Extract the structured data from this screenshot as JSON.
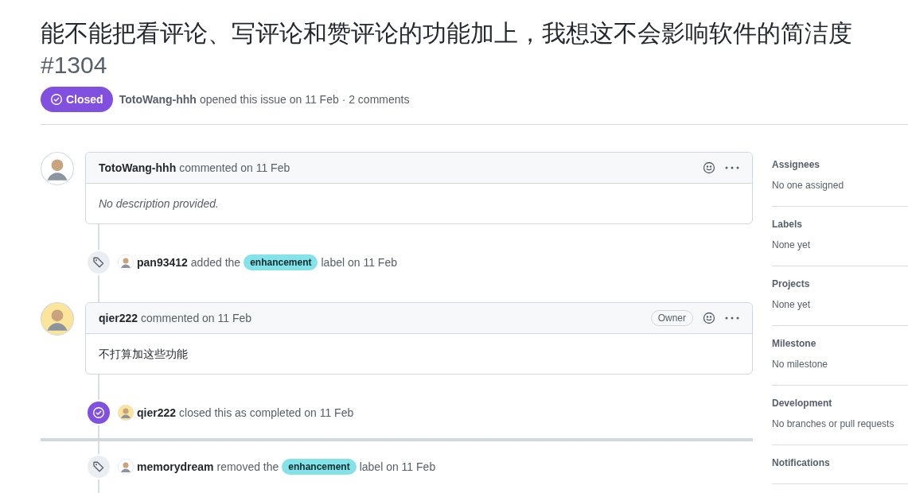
{
  "issue": {
    "title": "能不能把看评论、写评论和赞评论的功能加上，我想这不会影响软件的简洁度",
    "number": "#1304",
    "status": {
      "kind": "closed",
      "label": "Closed"
    },
    "author": "TotoWang-hhh",
    "meta": "opened this issue on 11 Feb · 2 comments"
  },
  "timeline": [
    {
      "kind": "comment",
      "author": "TotoWang-hhh",
      "action": "commented on 11 Feb",
      "body": "No description provided.",
      "empty": true
    },
    {
      "kind": "label_event",
      "actor": "pan93412",
      "before": "added the",
      "label": "enhancement",
      "after": "label on 11 Feb"
    },
    {
      "kind": "comment",
      "author": "qier222",
      "action": "commented on 11 Feb",
      "badge": "Owner",
      "body": "不打算加这些功能",
      "empty": false
    },
    {
      "kind": "close_event",
      "actor": "qier222",
      "before": "closed this as completed on 11 Feb"
    },
    {
      "kind": "label_event",
      "actor": "memorydream",
      "before": "removed the",
      "label": "enhancement",
      "after": "label on 11 Feb"
    }
  ],
  "sidebar": [
    {
      "heading": "Assignees",
      "value": "No one assigned"
    },
    {
      "heading": "Labels",
      "value": "None yet"
    },
    {
      "heading": "Projects",
      "value": "None yet"
    },
    {
      "heading": "Milestone",
      "value": "No milestone"
    },
    {
      "heading": "Development",
      "value": "No branches or pull requests"
    },
    {
      "heading": "Notifications"
    }
  ]
}
